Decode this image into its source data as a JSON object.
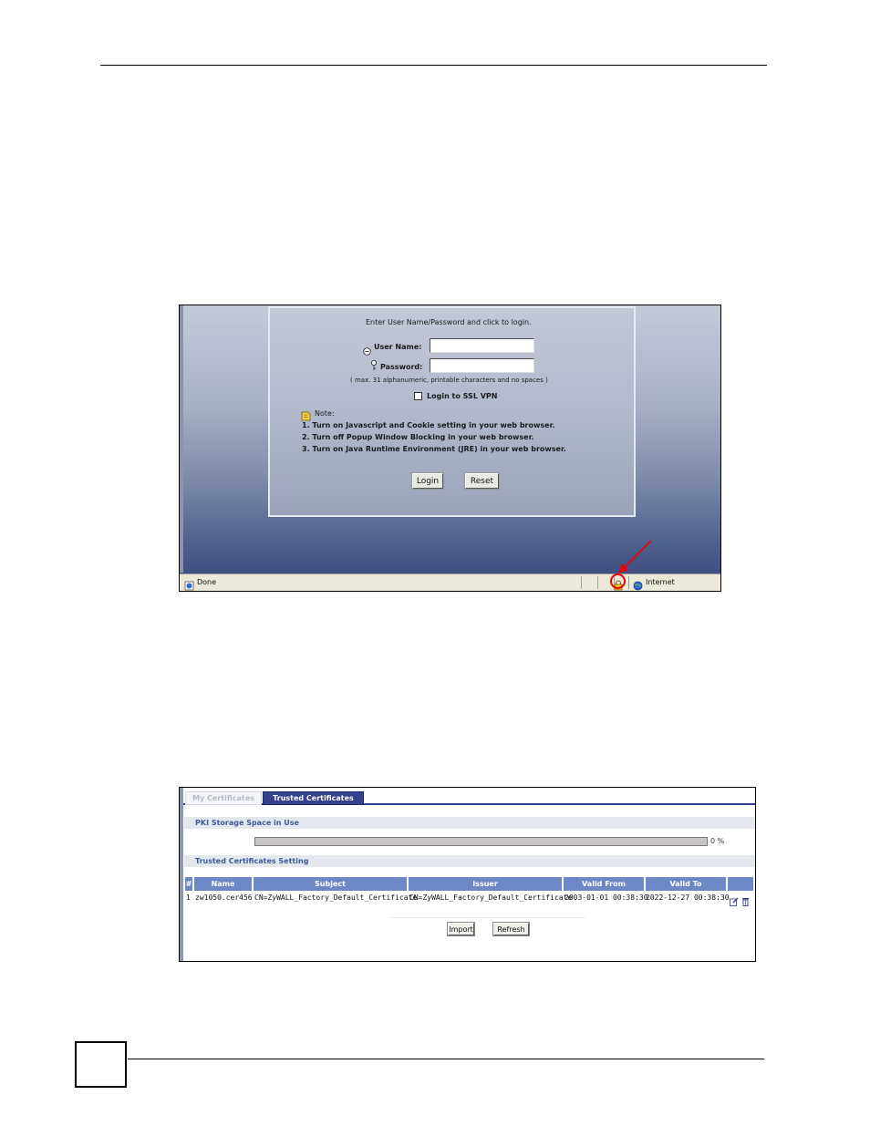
{
  "login_screenshot": {
    "prompt": "Enter User Name/Password and click to login.",
    "user_name_label": "User Name:",
    "password_label": "Password:",
    "password_hint": "( max. 31 alphanumeric, printable characters and no spaces )",
    "ssl_vpn_label": "Login to SSL VPN",
    "note_label": "Note:",
    "notes": [
      {
        "pre": "1. Turn on ",
        "bold": "Javascript and Cookie",
        "post": " setting in your web browser."
      },
      {
        "pre": "2. Turn off ",
        "bold": "Popup Window",
        "post": " Blocking in your web browser."
      },
      {
        "pre": "3. Turn on ",
        "bold": "Java Runtime Environment (JRE)",
        "post": " in your web browser."
      }
    ],
    "login_button": "Login",
    "reset_button": "Reset",
    "status_text": "Done",
    "zone_text": "Internet",
    "ssl_vpn_checked": false
  },
  "certificates_screenshot": {
    "tabs": [
      "My Certificates",
      "Trusted Certificates"
    ],
    "active_tab": "Trusted Certificates",
    "storage_section": "PKI Storage Space in Use",
    "storage_percent_label": "0 %",
    "storage_percent": 0,
    "setting_section": "Trusted Certificates Setting",
    "columns": [
      "#",
      "Name",
      "Subject",
      "Issuer",
      "Valid From",
      "Valid To"
    ],
    "rows": [
      {
        "index": "1",
        "name": "zw1050.cer456",
        "subject": "CN=ZyWALL_Factory_Default_Certificate",
        "issuer": "CN=ZyWALL_Factory_Default_Certificate",
        "valid_from": "2003-01-01 00:38:30",
        "valid_to": "2022-12-27 00:38:30"
      }
    ],
    "import_button": "Import",
    "refresh_button": "Refresh"
  },
  "icons": [
    "user-icon",
    "key-icon",
    "note-icon",
    "ie-page-icon",
    "lock-icon",
    "globe-icon",
    "edit-icon",
    "delete-icon",
    "red-arrow"
  ],
  "colors": {
    "accent": "#34418f",
    "table_header": "#6d88c6",
    "highlight": "#ee0000"
  }
}
